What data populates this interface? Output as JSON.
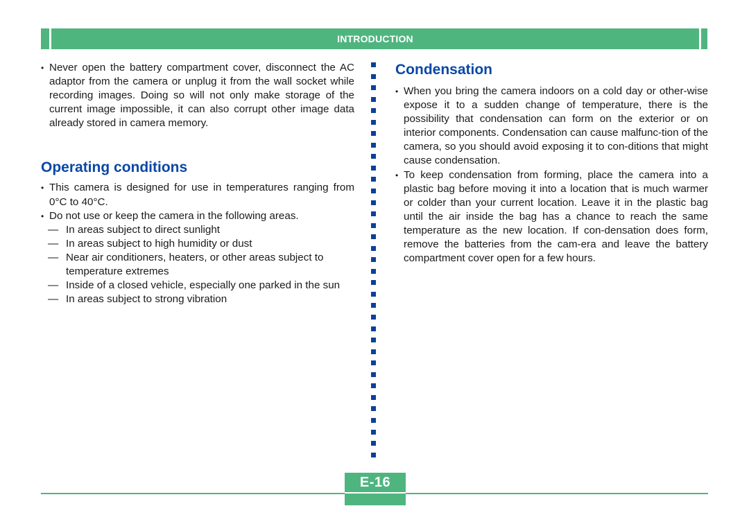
{
  "header": {
    "title": "INTRODUCTION",
    "accent_color": "#4fb57f"
  },
  "left_column": {
    "intro_bullets": [
      "Never open the battery compartment cover, disconnect the AC adaptor from the camera or unplug it from the wall socket while recording images. Doing so will not only make storage of the current image impossible, it can also corrupt other image data already stored in camera memory."
    ],
    "operating_conditions": {
      "title": "Operating conditions",
      "bullets": [
        "This camera is designed for use in temperatures ranging from 0°C to 40°C.",
        "Do not use or keep the camera in the following areas."
      ],
      "dash_items": [
        "In areas subject to direct sunlight",
        "In areas subject to high humidity or dust",
        "Near air conditioners, heaters, or other areas subject to temperature extremes",
        "Inside of a closed vehicle, especially one parked in the sun",
        "In areas subject to strong vibration"
      ]
    }
  },
  "right_column": {
    "condensation": {
      "title": "Condensation",
      "bullets": [
        "When you bring the camera indoors on a cold day or other-wise expose it to a sudden change of temperature, there is the possibility that condensation can form on the exterior or on interior components. Condensation can cause malfunc-tion of the camera, so you should avoid exposing it to con-ditions that might cause condensation.",
        "To keep condensation from forming, place the camera into a plastic bag before moving it into a location that is much warmer or colder than your current location. Leave it in the plastic bag until the air inside the bag has a chance to reach the same temperature as the new location. If con-densation does form, remove the batteries from the cam-era and leave the battery compartment cover open for a few hours."
      ]
    }
  },
  "footer": {
    "page_number": "E-16"
  },
  "colors": {
    "heading_blue": "#0a47a6",
    "divider_blue": "#0d3f9c",
    "green": "#4fb57f"
  }
}
